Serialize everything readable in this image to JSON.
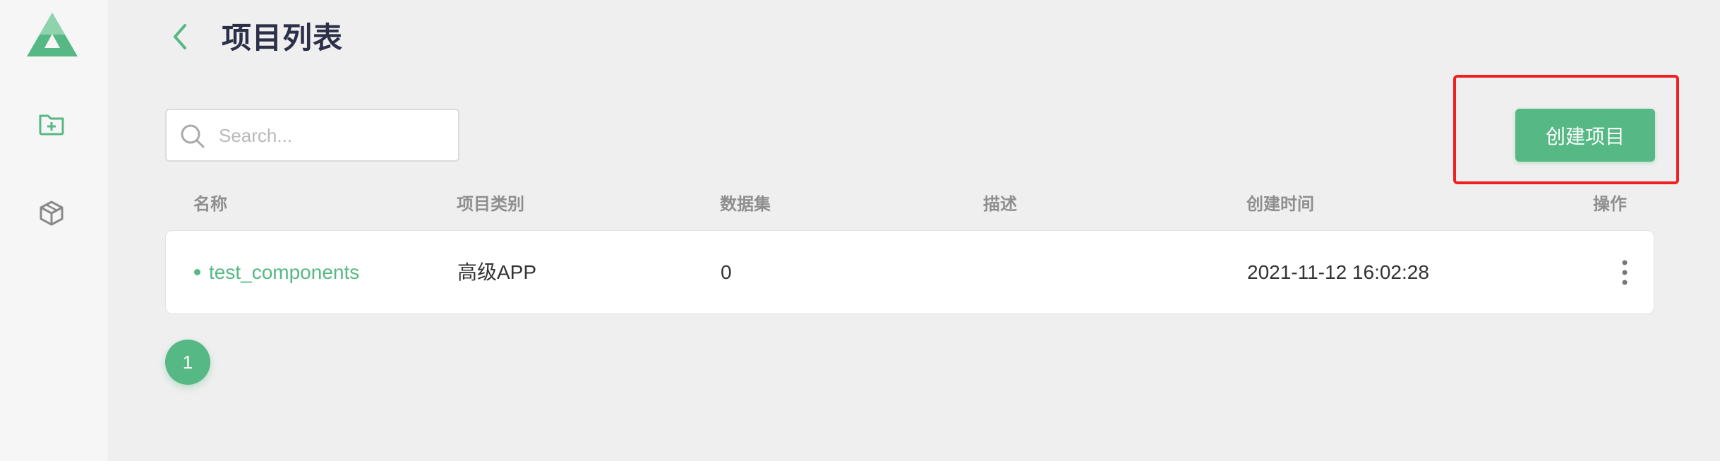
{
  "page": {
    "title": "项目列表"
  },
  "sidebar": {
    "items": [
      {
        "name": "projects",
        "icon": "folder-add-icon",
        "active": true
      },
      {
        "name": "packages",
        "icon": "cube-icon",
        "active": false
      }
    ]
  },
  "search": {
    "placeholder": "Search..."
  },
  "toolbar": {
    "create_label": "创建项目"
  },
  "table": {
    "columns": [
      "名称",
      "项目类别",
      "数据集",
      "描述",
      "创建时间",
      "操作"
    ],
    "rows": [
      {
        "name": "test_components",
        "category": "高级APP",
        "datasets": "0",
        "description": "",
        "created": "2021-11-12 16:02:28"
      }
    ]
  },
  "pagination": {
    "current": "1"
  },
  "colors": {
    "accent": "#56b884",
    "title": "#2b2f48",
    "highlight": "#ee2020"
  }
}
